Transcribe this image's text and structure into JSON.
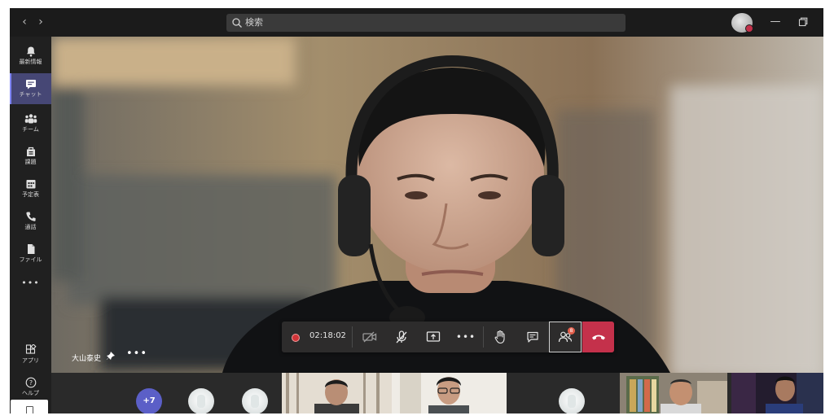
{
  "titlebar": {
    "back_icon": "chevron-left-icon",
    "forward_icon": "chevron-right-icon",
    "search_placeholder": "検索",
    "minimize_glyph": "—",
    "restore_icon": "restore-window-icon"
  },
  "rail": {
    "items": [
      {
        "label": "最新情報",
        "icon": "bell-icon"
      },
      {
        "label": "チャット",
        "icon": "chat-icon",
        "active": true
      },
      {
        "label": "チーム",
        "icon": "teams-icon"
      },
      {
        "label": "課題",
        "icon": "assignments-icon"
      },
      {
        "label": "予定表",
        "icon": "calendar-icon"
      },
      {
        "label": "通話",
        "icon": "phone-icon"
      },
      {
        "label": "ファイル",
        "icon": "file-icon"
      }
    ],
    "more": "•••",
    "apps_label": "アプリ",
    "help_label": "ヘルプ"
  },
  "stage": {
    "speaker_name": "大山泰史",
    "name_more": "•••"
  },
  "controls": {
    "recording_time": "02:18:02",
    "more": "•••",
    "participants_badge": "8",
    "colors": {
      "record": "#d13438",
      "hangup": "#c4314b",
      "badge": "#e35f4c"
    }
  },
  "strip": {
    "overflow_label": "+7"
  }
}
